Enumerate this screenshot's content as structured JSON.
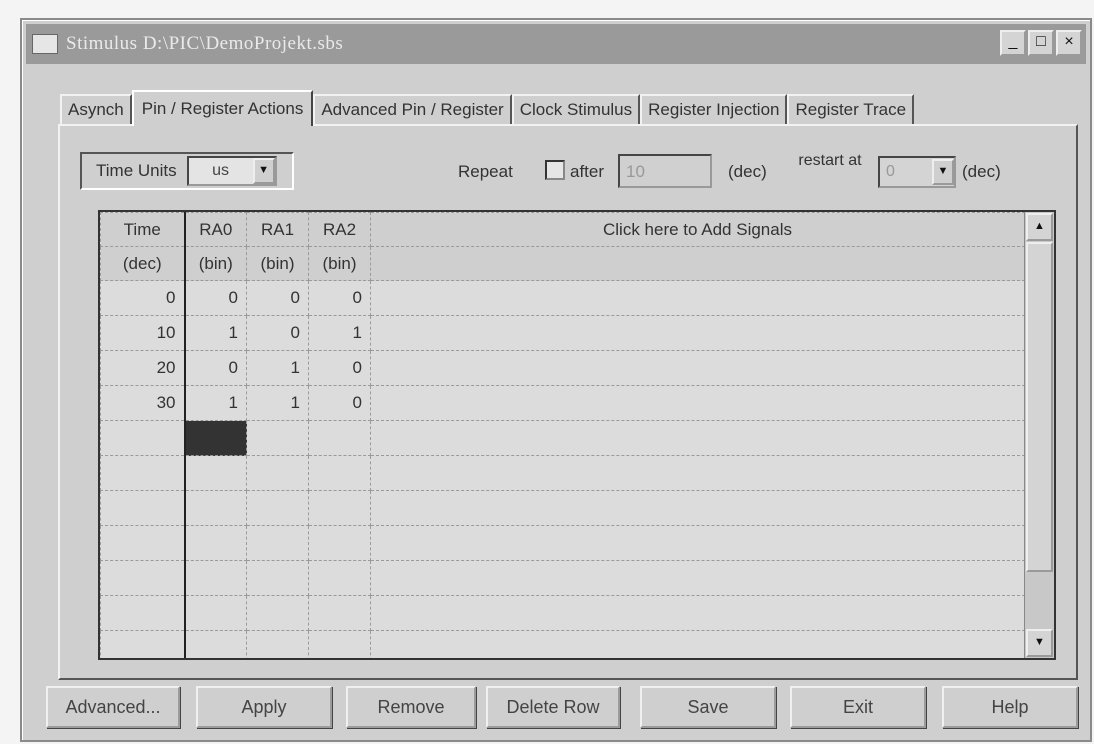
{
  "window": {
    "title": "Stimulus  D:\\PIC\\DemoProjekt.sbs",
    "min_label": "_",
    "max_label": "□",
    "close_label": "×"
  },
  "tabs": [
    {
      "label": "Asynch",
      "active": false
    },
    {
      "label": "Pin / Register Actions",
      "active": true
    },
    {
      "label": "Advanced Pin / Register",
      "active": false
    },
    {
      "label": "Clock Stimulus",
      "active": false
    },
    {
      "label": "Register Injection",
      "active": false
    },
    {
      "label": "Register Trace",
      "active": false
    }
  ],
  "controls": {
    "time_units_label": "Time Units",
    "time_units_value": "us",
    "repeat_label": "Repeat",
    "repeat_checked": false,
    "after_label": "after",
    "after_value": "10",
    "after_unit": "(dec)",
    "restart_label": "restart at",
    "restart_value": "0",
    "restart_unit": "(dec)"
  },
  "grid": {
    "headers": [
      "Time",
      "RA0",
      "RA1",
      "RA2",
      "Click here to Add Signals"
    ],
    "subheaders": [
      "(dec)",
      "(bin)",
      "(bin)",
      "(bin)",
      ""
    ],
    "rows": [
      [
        "0",
        "0",
        "0",
        "0"
      ],
      [
        "10",
        "1",
        "0",
        "1"
      ],
      [
        "20",
        "0",
        "1",
        "0"
      ],
      [
        "30",
        "1",
        "1",
        "0"
      ]
    ],
    "empty_rows": 7
  },
  "buttons": {
    "advanced": "Advanced...",
    "apply": "Apply",
    "remove": "Remove",
    "delete_row": "Delete Row",
    "save": "Save",
    "exit": "Exit",
    "help": "Help"
  },
  "icons": {
    "dropdown": "▼",
    "scroll_up": "▲",
    "scroll_down": "▼"
  }
}
